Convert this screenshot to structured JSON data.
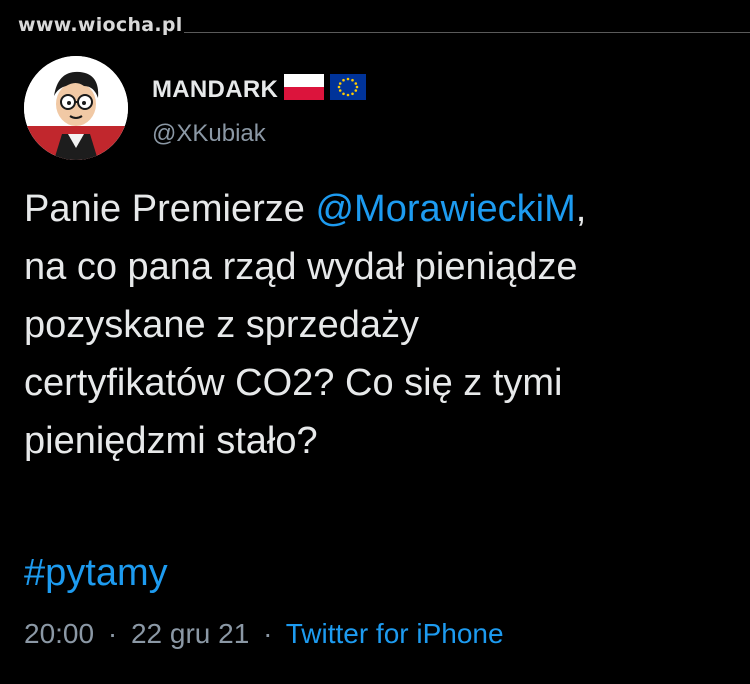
{
  "watermark": "www.wiocha.pl",
  "author": {
    "display_name": "MANDARK",
    "handle": "@XKubiak",
    "avatar_icon": "cartoon-avatar-icon",
    "flags": [
      "poland-flag-icon",
      "eu-flag-icon"
    ]
  },
  "tweet": {
    "line1_prefix": "Panie Premierze ",
    "mention": "@MorawieckiM",
    "line1_suffix": ",",
    "line2": "na co pana rząd wydał pieniądze",
    "line3": "pozyskane z sprzedaży",
    "line4": "certyfikatów CO2? Co się z tymi",
    "line5": "pieniędzmi stało?",
    "hashtag": "#pytamy"
  },
  "meta": {
    "time": "20:00",
    "date": "22 gru 21",
    "separator": "·",
    "source": "Twitter for iPhone"
  },
  "colors": {
    "background": "#000000",
    "text": "#e7e9ea",
    "secondary": "#8b98a5",
    "link": "#1d9bf0"
  }
}
